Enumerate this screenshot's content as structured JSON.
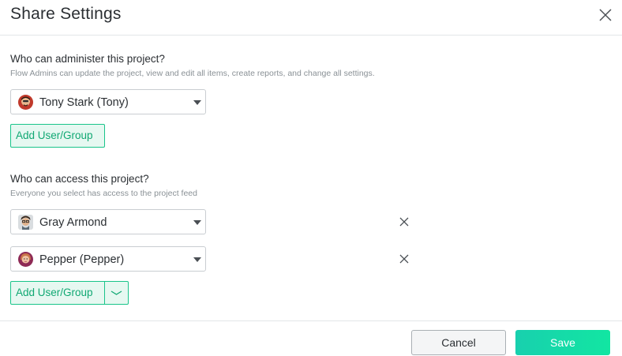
{
  "dialog": {
    "title": "Share Settings"
  },
  "admin_section": {
    "heading": "Who can administer this project?",
    "description": "Flow Admins can update the project, view and edit all items, create reports, and change all settings.",
    "users": [
      {
        "name": "Tony Stark (Tony)",
        "avatar": "tony-avatar-icon"
      }
    ],
    "add_button_label": "Add User/Group"
  },
  "access_section": {
    "heading": "Who can access this project?",
    "description": "Everyone you select has access to the project feed",
    "users": [
      {
        "name": "Gray Armond",
        "avatar": "gray-avatar-icon"
      },
      {
        "name": "Pepper (Pepper)",
        "avatar": "pepper-avatar-icon"
      }
    ],
    "add_button_label": "Add User/Group"
  },
  "footer": {
    "cancel_label": "Cancel",
    "save_label": "Save"
  },
  "colors": {
    "accent": "#19c48a",
    "save_gradient_start": "#18d0ae",
    "save_gradient_end": "#12e6a2"
  }
}
